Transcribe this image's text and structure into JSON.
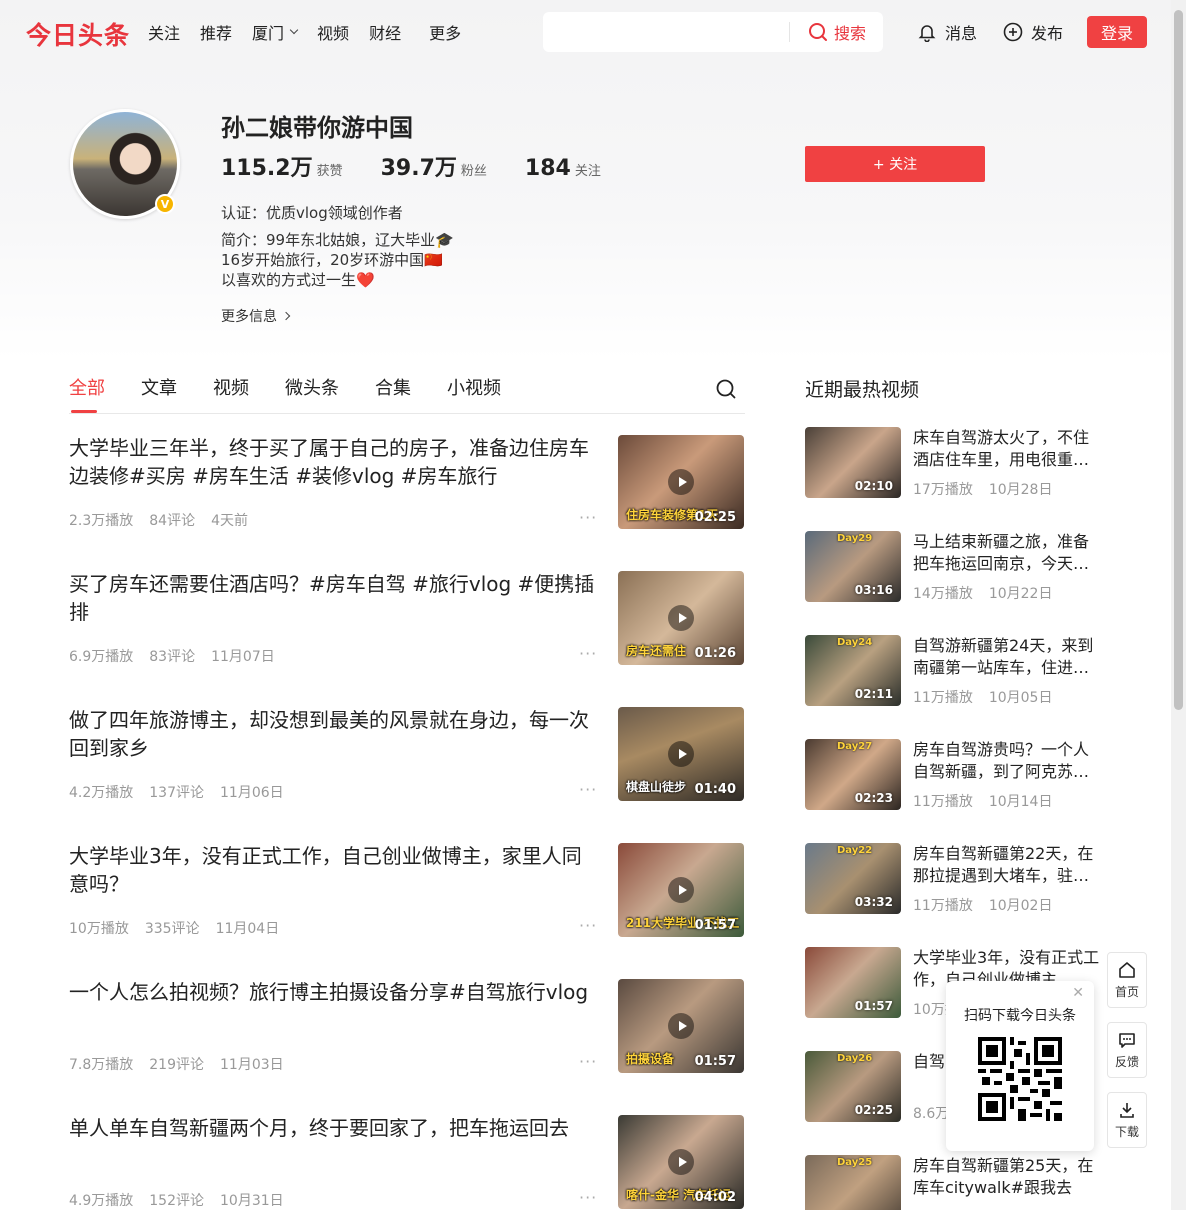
{
  "header": {
    "logo": "今日头条",
    "nav": [
      "关注",
      "推荐",
      "厦门",
      "视频",
      "财经",
      "更多"
    ],
    "search_placeholder": "",
    "search_label": "搜索",
    "messages_label": "消息",
    "publish_label": "发布",
    "login_label": "登录"
  },
  "profile": {
    "name": "孙二娘带你游中国",
    "stats": [
      {
        "num": "115.2万",
        "label": "获赞"
      },
      {
        "num": "39.7万",
        "label": "粉丝"
      },
      {
        "num": "184",
        "label": "关注"
      }
    ],
    "follow_label": "+ 关注",
    "cert": "认证：优质vlog领域创作者",
    "bio": [
      "简介：99年东北姑娘，辽大毕业🎓",
      "16岁开始旅行，20岁环游中国🇨🇳",
      "以喜欢的方式过一生❤️"
    ],
    "more_info": "更多信息"
  },
  "tabs": [
    "全部",
    "文章",
    "视频",
    "微头条",
    "合集",
    "小视频"
  ],
  "feed": [
    {
      "title": "大学毕业三年半，终于买了属于自己的房子，准备边住房车边装修#买房 #房车生活 #装修vlog #房车旅行",
      "plays": "2.3万播放",
      "comments": "84评论",
      "time": "4天前",
      "duration": "02:25",
      "caption": "住房车装修第1天"
    },
    {
      "title": "买了房车还需要住酒店吗？#房车自驾 #旅行vlog #便携插排",
      "plays": "6.9万播放",
      "comments": "83评论",
      "time": "11月07日",
      "duration": "01:26",
      "caption": "房车还需住"
    },
    {
      "title": "做了四年旅游博主，却没想到最美的风景就在身边，每一次回到家乡",
      "plays": "4.2万播放",
      "comments": "137评论",
      "time": "11月06日",
      "duration": "01:40",
      "caption": "棋盘山徒步"
    },
    {
      "title": "大学毕业3年，没有正式工作，自己创业做博主，家里人同意吗？",
      "plays": "10万播放",
      "comments": "335评论",
      "time": "11月04日",
      "duration": "01:57",
      "caption": "211大学毕业 不找工"
    },
    {
      "title": "一个人怎么拍视频？旅行博主拍摄设备分享#自驾旅行vlog",
      "plays": "7.8万播放",
      "comments": "219评论",
      "time": "11月03日",
      "duration": "01:57",
      "caption": "拍摄设备"
    },
    {
      "title": "单人单车自驾新疆两个月，终于要回家了，把车拖运回去",
      "plays": "4.9万播放",
      "comments": "152评论",
      "time": "10月31日",
      "duration": "04:02",
      "caption": "喀什-金华 汽车托运"
    }
  ],
  "sidebar": {
    "title": "近期最热视频",
    "items": [
      {
        "title": "床车自驾游太火了，不住酒店住车里，用电很重…",
        "plays": "17万播放",
        "date": "10月28日",
        "duration": "02:10",
        "tag": ""
      },
      {
        "title": "马上结束新疆之旅，准备把车拖运回南京，今天…",
        "plays": "14万播放",
        "date": "10月22日",
        "duration": "03:16",
        "tag": "Day29"
      },
      {
        "title": "自驾游新疆第24天，来到南疆第一站库车，住进…",
        "plays": "11万播放",
        "date": "10月05日",
        "duration": "02:11",
        "tag": "Day24"
      },
      {
        "title": "房车自驾游贵吗？一个人自驾新疆，到了阿克苏…",
        "plays": "11万播放",
        "date": "10月14日",
        "duration": "02:23",
        "tag": "Day27"
      },
      {
        "title": "房车自驾新疆第22天，在那拉提遇到大堵车，驻…",
        "plays": "11万播放",
        "date": "10月02日",
        "duration": "03:32",
        "tag": "Day22"
      },
      {
        "title": "大学毕业3年，没有正式工作，自己创业做博主…",
        "plays": "10万播放",
        "date": "",
        "duration": "01:57",
        "tag": ""
      },
      {
        "title": "自驾…克苏…",
        "plays": "8.6万播放",
        "date": "",
        "duration": "02:25",
        "tag": "Day26"
      },
      {
        "title": "房车自驾新疆第25天，在库车citywalk#跟我去旅…",
        "plays": "",
        "date": "",
        "duration": "",
        "tag": "Day25"
      }
    ]
  },
  "float": {
    "home": "首页",
    "feedback": "反馈",
    "download": "下载",
    "qr_title": "扫码下载今日头条"
  },
  "colors": {
    "accent": "#f04142",
    "logo": "#e8353d"
  }
}
